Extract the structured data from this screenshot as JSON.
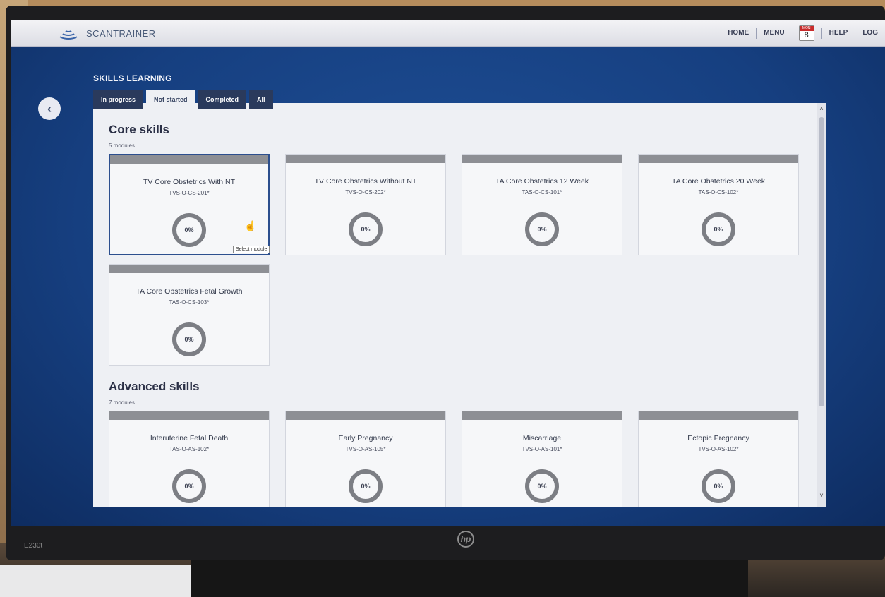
{
  "header": {
    "app_name": "SCANTRAINER",
    "nav": [
      "HOME",
      "MENU",
      "HELP",
      "LOG"
    ],
    "calendar": {
      "weekday": "MON",
      "day": "8"
    }
  },
  "page": {
    "title": "SKILLS LEARNING",
    "tabs": [
      "In progress",
      "Not started",
      "Completed",
      "All"
    ],
    "active_tab": "Not started"
  },
  "groups": [
    {
      "title": "Core skills",
      "count": "5 modules",
      "modules": [
        {
          "name": "TV Core Obstetrics With NT",
          "code": "TVS-O-CS-201*",
          "progress": "0%"
        },
        {
          "name": "TV Core Obstetrics Without NT",
          "code": "TVS-O-CS-202*",
          "progress": "0%"
        },
        {
          "name": "TA Core Obstetrics 12 Week",
          "code": "TAS-O-CS-101*",
          "progress": "0%"
        },
        {
          "name": "TA Core Obstetrics 20 Week",
          "code": "TAS-O-CS-102*",
          "progress": "0%"
        },
        {
          "name": "TA Core Obstetrics Fetal Growth",
          "code": "TAS-O-CS-103*",
          "progress": "0%"
        }
      ]
    },
    {
      "title": "Advanced skills",
      "count": "7 modules",
      "modules": [
        {
          "name": "Interuterine Fetal Death",
          "code": "TAS-O-AS-102*",
          "progress": "0%"
        },
        {
          "name": "Early Pregnancy",
          "code": "TVS-O-AS-105*",
          "progress": "0%"
        },
        {
          "name": "Miscarriage",
          "code": "TVS-O-AS-101*",
          "progress": "0%"
        },
        {
          "name": "Ectopic Pregnancy",
          "code": "TVS-O-AS-102*",
          "progress": "0%"
        }
      ]
    }
  ],
  "tooltip": "Select module",
  "device": {
    "model": "E230t",
    "brand": "hp"
  }
}
